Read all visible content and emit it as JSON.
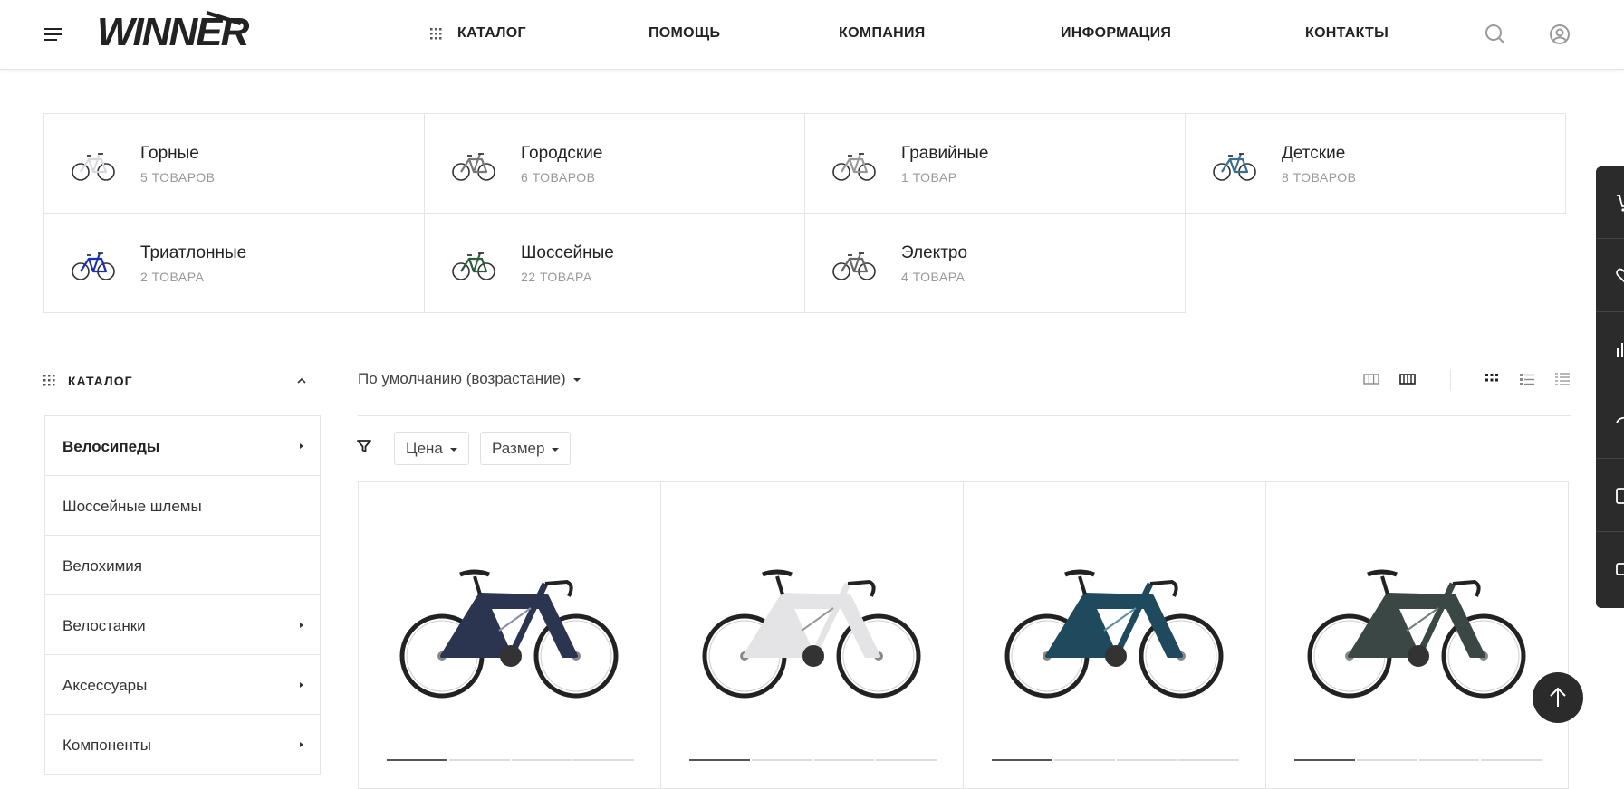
{
  "header": {
    "logo_text": "WINNER",
    "nav": [
      {
        "label": "КАТАЛОГ"
      },
      {
        "label": "ПОМОЩЬ"
      },
      {
        "label": "КОМПАНИЯ"
      },
      {
        "label": "ИНФОРМАЦИЯ"
      },
      {
        "label": "КОНТАКТЫ"
      }
    ],
    "icons": [
      "menu-icon",
      "grid-icon",
      "search-icon",
      "user-icon"
    ]
  },
  "categories": [
    {
      "name": "Горные",
      "count": "5 ТОВАРОВ",
      "frame_color": "#d8d8e0"
    },
    {
      "name": "Городские",
      "count": "6 ТОВАРОВ",
      "frame_color": "#777777"
    },
    {
      "name": "Гравийные",
      "count": "1 ТОВАР",
      "frame_color": "#999999"
    },
    {
      "name": "Детские",
      "count": "8 ТОВАРОВ",
      "frame_color": "#3a6e8f"
    },
    {
      "name": "Триатлонные",
      "count": "2 ТОВАРА",
      "frame_color": "#1a2fb0"
    },
    {
      "name": "Шоссейные",
      "count": "22 ТОВАРА",
      "frame_color": "#2e5c3a"
    },
    {
      "name": "Электро",
      "count": "4 ТОВАРА",
      "frame_color": "#666666"
    }
  ],
  "sidebar": {
    "title": "КАТАЛОГ",
    "items": [
      {
        "label": "Велосипеды",
        "has_children": true,
        "active": true
      },
      {
        "label": "Шоссейные шлемы",
        "has_children": false
      },
      {
        "label": "Велохимия",
        "has_children": false
      },
      {
        "label": "Велостанки",
        "has_children": true
      },
      {
        "label": "Аксессуары",
        "has_children": true
      },
      {
        "label": "Компоненты",
        "has_children": true
      }
    ]
  },
  "toolbar": {
    "sort_label": "По умолчанию (возрастание)",
    "filters": [
      {
        "label": "Цена"
      },
      {
        "label": "Размер"
      }
    ],
    "view_icons": [
      "columns-3-icon",
      "columns-4-icon",
      "grid-view-icon",
      "list-view-icon",
      "compact-list-icon"
    ]
  },
  "products": [
    {
      "frame_color": "#2c3550",
      "accent": "#8a8fa8"
    },
    {
      "frame_color": "#e4e4e6",
      "accent": "#999999"
    },
    {
      "frame_color": "#1f4a5e",
      "accent": "#5a8fa0"
    },
    {
      "frame_color": "#3a4744",
      "accent": "#6f7f7a"
    }
  ],
  "side_panel_icons": [
    "cart-icon",
    "heart-icon",
    "compare-icon",
    "eye-icon",
    "doc-icon",
    "mail-icon"
  ],
  "colors": {
    "accent_dark": "#2b2b2b",
    "border": "#e5e5e5"
  }
}
